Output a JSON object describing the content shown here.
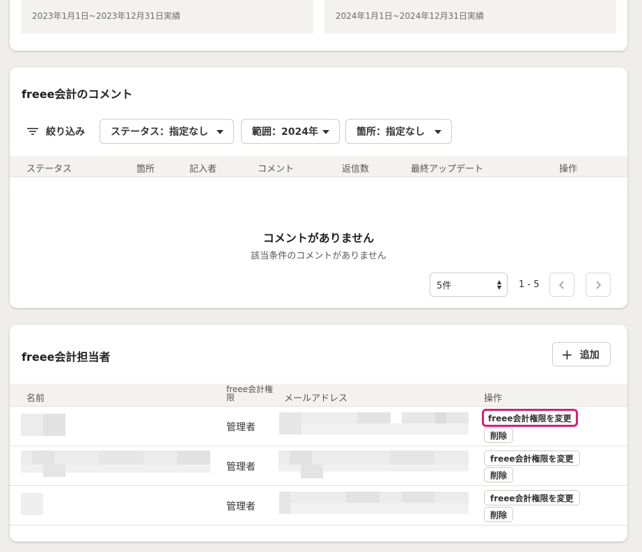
{
  "periods": {
    "period_2023": "2023年1月1日~2023年12月31日実績",
    "period_2024": "2024年1月1日~2024年12月31日実績"
  },
  "comments": {
    "title": "freee会計のコメント",
    "filter_label": "絞り込み",
    "dropdowns": {
      "status": "ステータス：指定なし",
      "range": "範囲：2024年",
      "place": "箇所：指定なし"
    },
    "columns": [
      "ステータス",
      "箇所",
      "記入者",
      "コメント",
      "返信数",
      "最終アップデート",
      "操作"
    ],
    "empty_title": "コメントがありません",
    "empty_sub": "該当条件のコメントがありません",
    "per_page": "5件",
    "range_text": "1 - 5"
  },
  "members": {
    "title": "freee会計担当者",
    "add_label": "追加",
    "columns": {
      "name": "名前",
      "permission": "freee会計権限",
      "email": "メールアドレス",
      "actions": "操作"
    },
    "rows": [
      {
        "role": "管理者",
        "change_label": "freee会計権限を変更",
        "delete_label": "削除"
      },
      {
        "role": "管理者",
        "change_label": "freee会計権限を変更",
        "delete_label": "削除"
      },
      {
        "role": "管理者",
        "change_label": "freee会計権限を変更",
        "delete_label": "削除"
      }
    ]
  },
  "colors": {
    "background": "#f0eeea",
    "highlight": "#e6186e",
    "header_bg": "#f4f2ef"
  }
}
